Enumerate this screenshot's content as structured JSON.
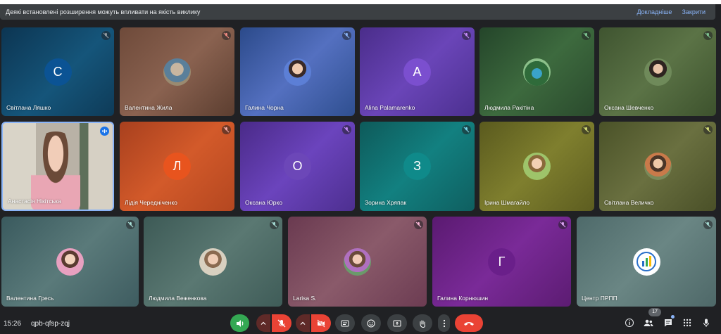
{
  "banner": {
    "message": "Деякі встановлені розширення можуть впливати на якість виклику",
    "more_label": "Докладніше",
    "close_label": "Закрити"
  },
  "participants": [
    {
      "name": "Світлана Ляшко",
      "initial": "С"
    },
    {
      "name": "Валентина Жила",
      "initial": ""
    },
    {
      "name": "Галина Чорна",
      "initial": ""
    },
    {
      "name": "Alina Palamarenko",
      "initial": "A"
    },
    {
      "name": "Людмила Ракітіна",
      "initial": ""
    },
    {
      "name": "Оксана Шевченко",
      "initial": ""
    },
    {
      "name": "Анастасія Нікітська",
      "initial": ""
    },
    {
      "name": "Лідія Чередніченко",
      "initial": "Л"
    },
    {
      "name": "Оксана Юрко",
      "initial": "О"
    },
    {
      "name": "Зорина Хряпак",
      "initial": "З"
    },
    {
      "name": "Ірина Шмагайло",
      "initial": ""
    },
    {
      "name": "Світлана Величко",
      "initial": ""
    },
    {
      "name": "Валентина Гресь",
      "initial": ""
    },
    {
      "name": "Людмила Веженкова",
      "initial": ""
    },
    {
      "name": "Larisa S.",
      "initial": ""
    },
    {
      "name": "Галина Корнюшин",
      "initial": "Г"
    },
    {
      "name": "Центр ПРПП",
      "initial": ""
    }
  ],
  "bottom": {
    "time": "15:26",
    "meeting_code": "qpb-qfsp-zqj",
    "participants_badge": "17"
  },
  "colors": {
    "accent_link": "#8ab4f8",
    "danger": "#ea4335",
    "speaking": "#34a853"
  }
}
